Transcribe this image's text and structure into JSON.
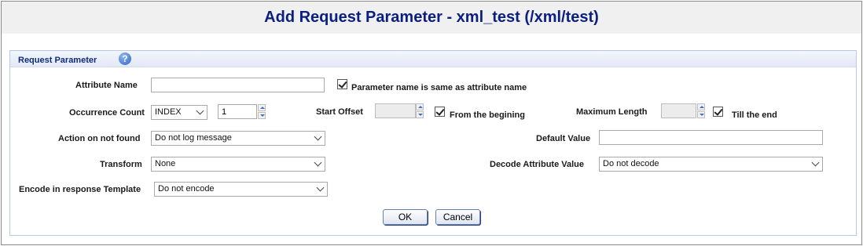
{
  "header": {
    "title": "Add Request Parameter - xml_test (/xml/test)"
  },
  "panel": {
    "title": "Request Parameter",
    "help_icon": "question-circle-icon"
  },
  "fields": {
    "attribute_name": {
      "label": "Attribute Name",
      "value": ""
    },
    "param_same_checkbox": {
      "label": "Parameter name is same as attribute name",
      "checked": true
    },
    "occurrence_count": {
      "label": "Occurrence Count",
      "selected": "INDEX",
      "count_value": "1"
    },
    "start_offset": {
      "label": "Start Offset",
      "value": ""
    },
    "from_beginning": {
      "label": "From the begining",
      "checked": true
    },
    "maximum_length": {
      "label": "Maximum Length",
      "value": ""
    },
    "till_end": {
      "label": "Till the end",
      "checked": true
    },
    "action_not_found": {
      "label": "Action on not found",
      "selected": "Do not log message"
    },
    "default_value": {
      "label": "Default Value",
      "value": ""
    },
    "transform": {
      "label": "Transform",
      "selected": "None"
    },
    "decode_attribute": {
      "label": "Decode Attribute Value",
      "selected": "Do not decode"
    },
    "encode_response": {
      "label": "Encode in response Template",
      "selected": "Do not encode"
    }
  },
  "buttons": {
    "ok": "OK",
    "cancel": "Cancel"
  },
  "colors": {
    "title": "#0b1f80",
    "panel_title": "#102a78",
    "spinner_arrow": "#3b6fc8"
  }
}
